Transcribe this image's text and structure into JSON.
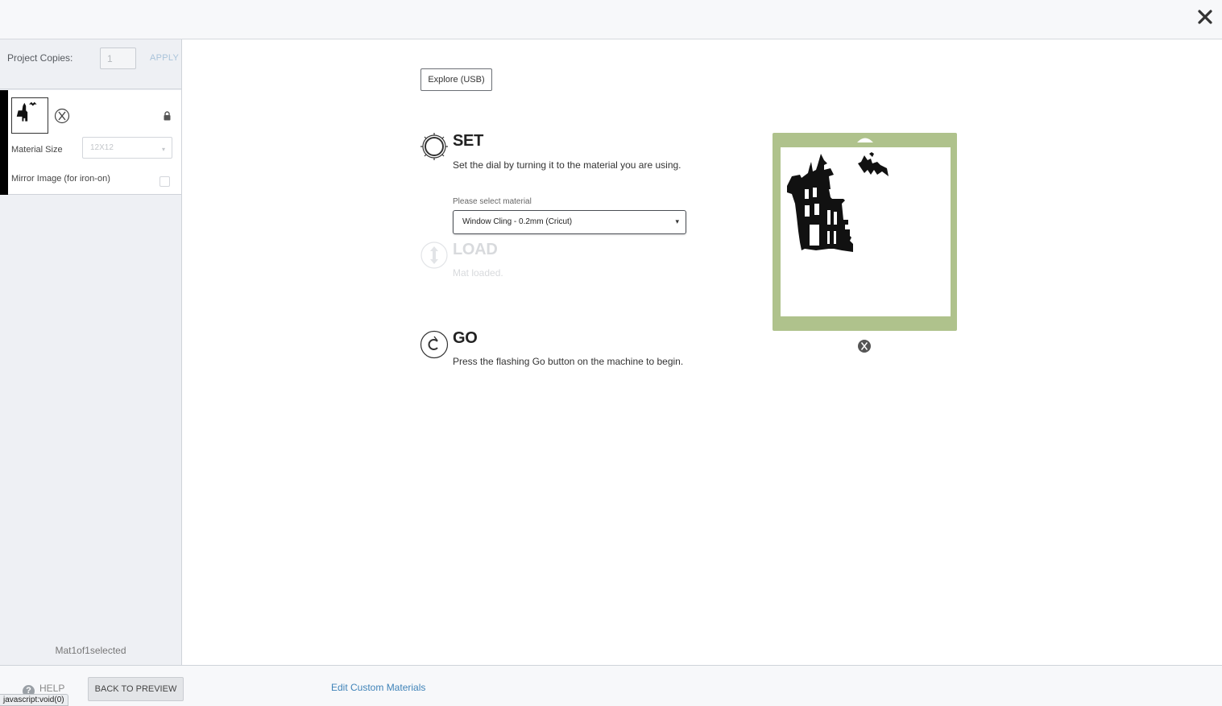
{
  "left_panel": {
    "copies_label": "Project Copies:",
    "copies_value": "1",
    "apply_label": "APPLY",
    "mat": {
      "material_size_label": "Material Size",
      "material_size_value": "12X12",
      "mirror_label": "Mirror Image (for iron-on)",
      "mirror_checked": false
    },
    "mat_count": "Mat1of1selected"
  },
  "main": {
    "machine_button": "Explore (USB)",
    "steps": [
      {
        "title": "SET",
        "description": "Set the dial by turning it to the material you are using.",
        "icon": "dial-icon"
      },
      {
        "title": "LOAD",
        "description": "Mat loaded.",
        "icon": "load-arrows-icon",
        "disabled": true
      },
      {
        "title": "GO",
        "description": "Press the flashing Go button on the machine to begin.",
        "icon": "go-icon"
      }
    ],
    "material_select": {
      "label": "Please select material",
      "value": "Window Cling - 0.2mm (Cricut)"
    }
  },
  "mat_preview": {
    "mat_color": "#afc28c",
    "content": "haunted-house-and-bat-image"
  },
  "footer": {
    "help_label": "HELP",
    "back_label": "BACK TO PREVIEW",
    "edit_custom_label": "Edit Custom Materials"
  },
  "status_bar": {
    "text": "javascript:void(0)"
  }
}
